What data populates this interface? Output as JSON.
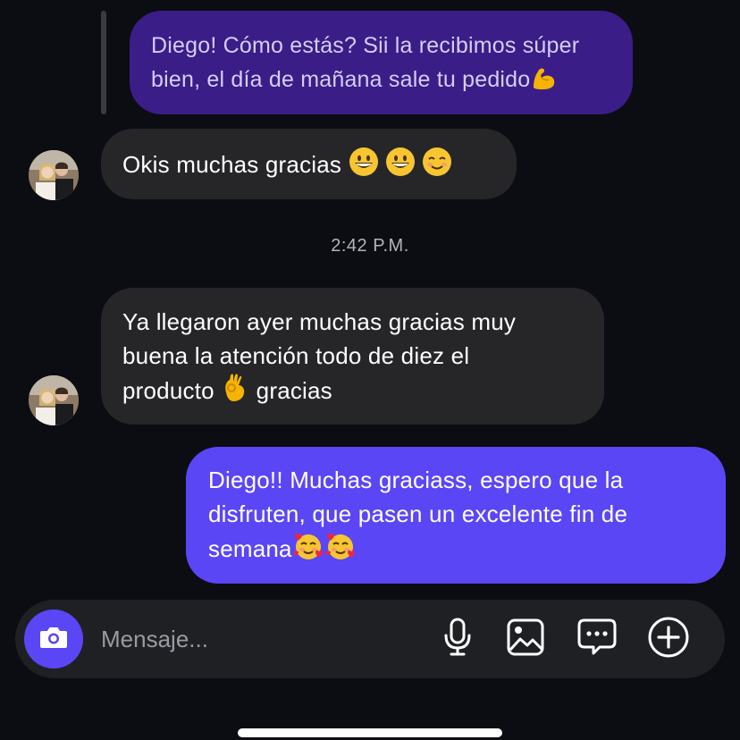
{
  "messages": {
    "quoted": {
      "line1": "Diego! Cómo estás? Sii la recibimos súper",
      "line2": "bien, el día de mañana sale tu pedido",
      "emoji": "flexed-biceps-emoji"
    },
    "incoming_1": {
      "text": "Okis muchas gracias",
      "emojis": [
        "grinning-face-emoji",
        "grinning-face-emoji",
        "smiling-face-emoji"
      ]
    },
    "timestamp": "2:42 P.M.",
    "incoming_2": {
      "line1": "Ya llegaron ayer muchas gracias muy",
      "line2": "buena la atención todo de diez el",
      "line3_before": "producto",
      "line3_emoji": "ok-hand-emoji",
      "line3_after": "gracias"
    },
    "outgoing": {
      "line1": "Diego!! Muchas graciass, espero que la",
      "line2": "disfruten, que pasen un excelente fin de",
      "line3": "semana",
      "emojis": [
        "smiling-face-with-hearts-emoji",
        "smiling-face-with-hearts-emoji"
      ]
    }
  },
  "composer": {
    "placeholder": "Mensaje...",
    "icons": [
      "camera-icon",
      "microphone-icon",
      "gallery-icon",
      "sticker-icon",
      "add-icon"
    ]
  },
  "colors": {
    "background": "#0b0d13",
    "outgoing_bubble": "#5b46f5",
    "quoted_bubble": "#3b1d88",
    "incoming_bubble": "#262629",
    "composer": "#1f2024"
  }
}
